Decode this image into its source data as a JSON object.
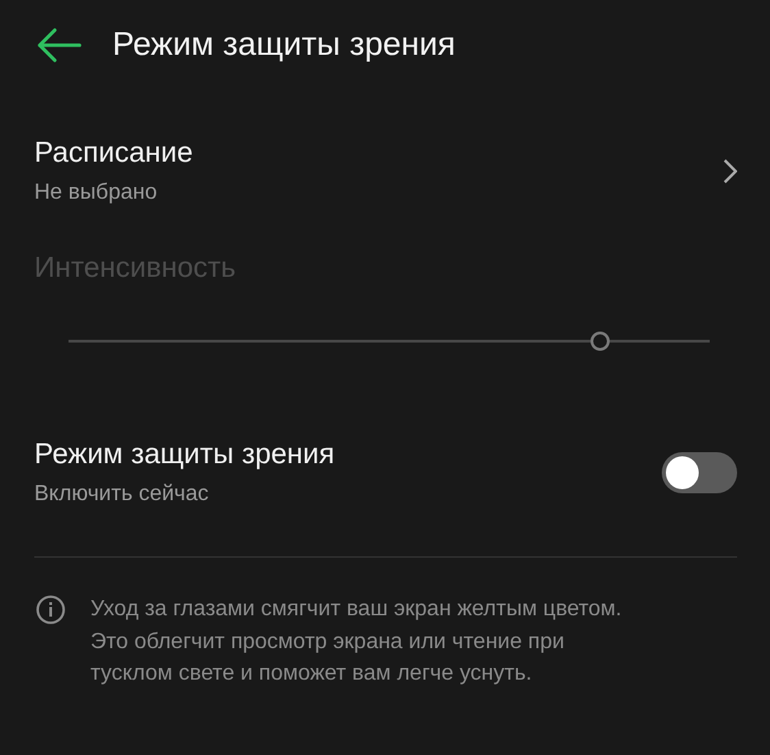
{
  "header": {
    "title": "Режим защиты зрения"
  },
  "schedule": {
    "title": "Расписание",
    "value": "Не выбрано"
  },
  "intensity": {
    "label": "Интенсивность",
    "disabled": true,
    "level": 0.83
  },
  "eye_mode": {
    "title": "Режим защиты зрения",
    "subtitle": "Включить сейчас",
    "on": false
  },
  "info": {
    "text": "Уход за глазами смягчит ваш экран желтым цветом. Это облегчит просмотр экрана или чтение при тусклом свете и поможет вам легче уснуть."
  }
}
